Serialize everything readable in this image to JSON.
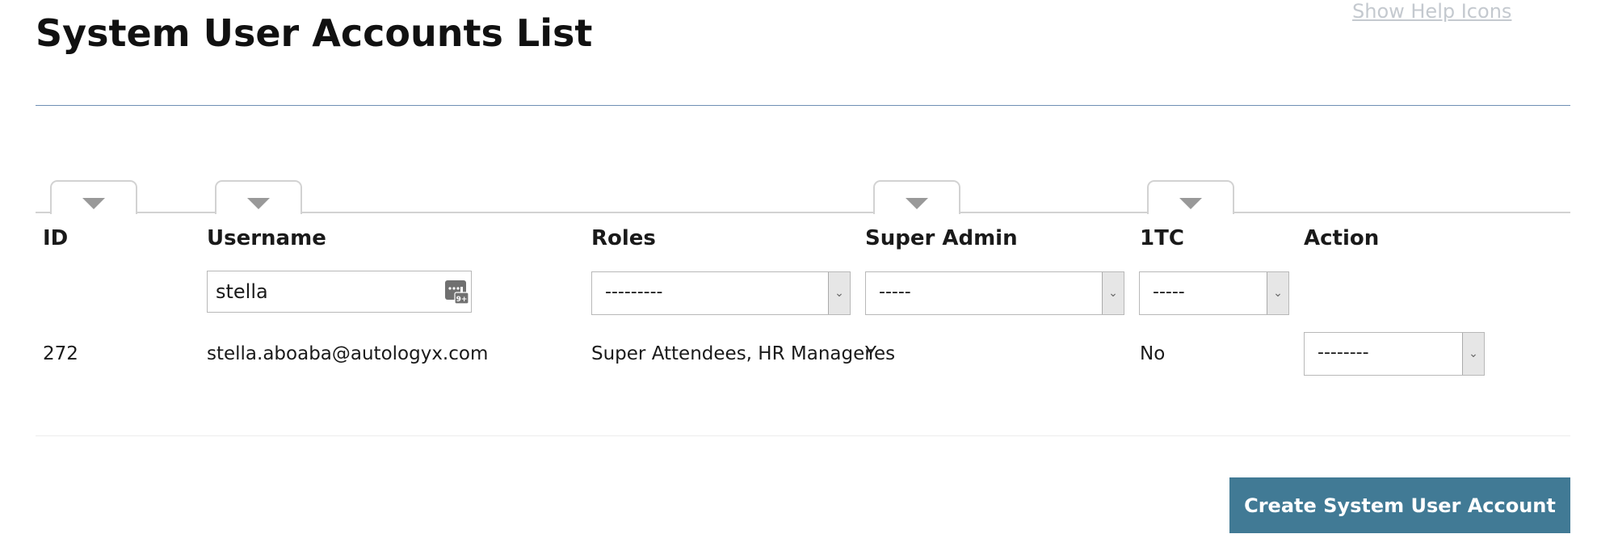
{
  "header": {
    "help_link": "Show Help Icons",
    "title": "System User Accounts List"
  },
  "table": {
    "columns": [
      {
        "label": "ID"
      },
      {
        "label": "Username"
      },
      {
        "label": "Roles"
      },
      {
        "label": "Super Admin"
      },
      {
        "label": "1TC"
      },
      {
        "label": "Action"
      }
    ],
    "filters": {
      "username_value": "stella",
      "roles_selected": "---------",
      "super_admin_selected": "-----",
      "tc_selected": "-----"
    },
    "rows": [
      {
        "id": "272",
        "username": "stella.aboaba@autologyx.com",
        "roles": "Super Attendees, HR Manager",
        "super_admin": "Yes",
        "tc": "No",
        "action_selected": "--------"
      }
    ]
  },
  "footer": {
    "create_button": "Create System User Account"
  },
  "colors": {
    "accent": "#417a95",
    "rule": "#6e8fb4",
    "help_link": "#c4c9cf"
  },
  "icons": {
    "filter_tab": "chevron-down-icon",
    "keyboard": "keyboard-icon",
    "select_arrow": "chevron-down-icon"
  }
}
